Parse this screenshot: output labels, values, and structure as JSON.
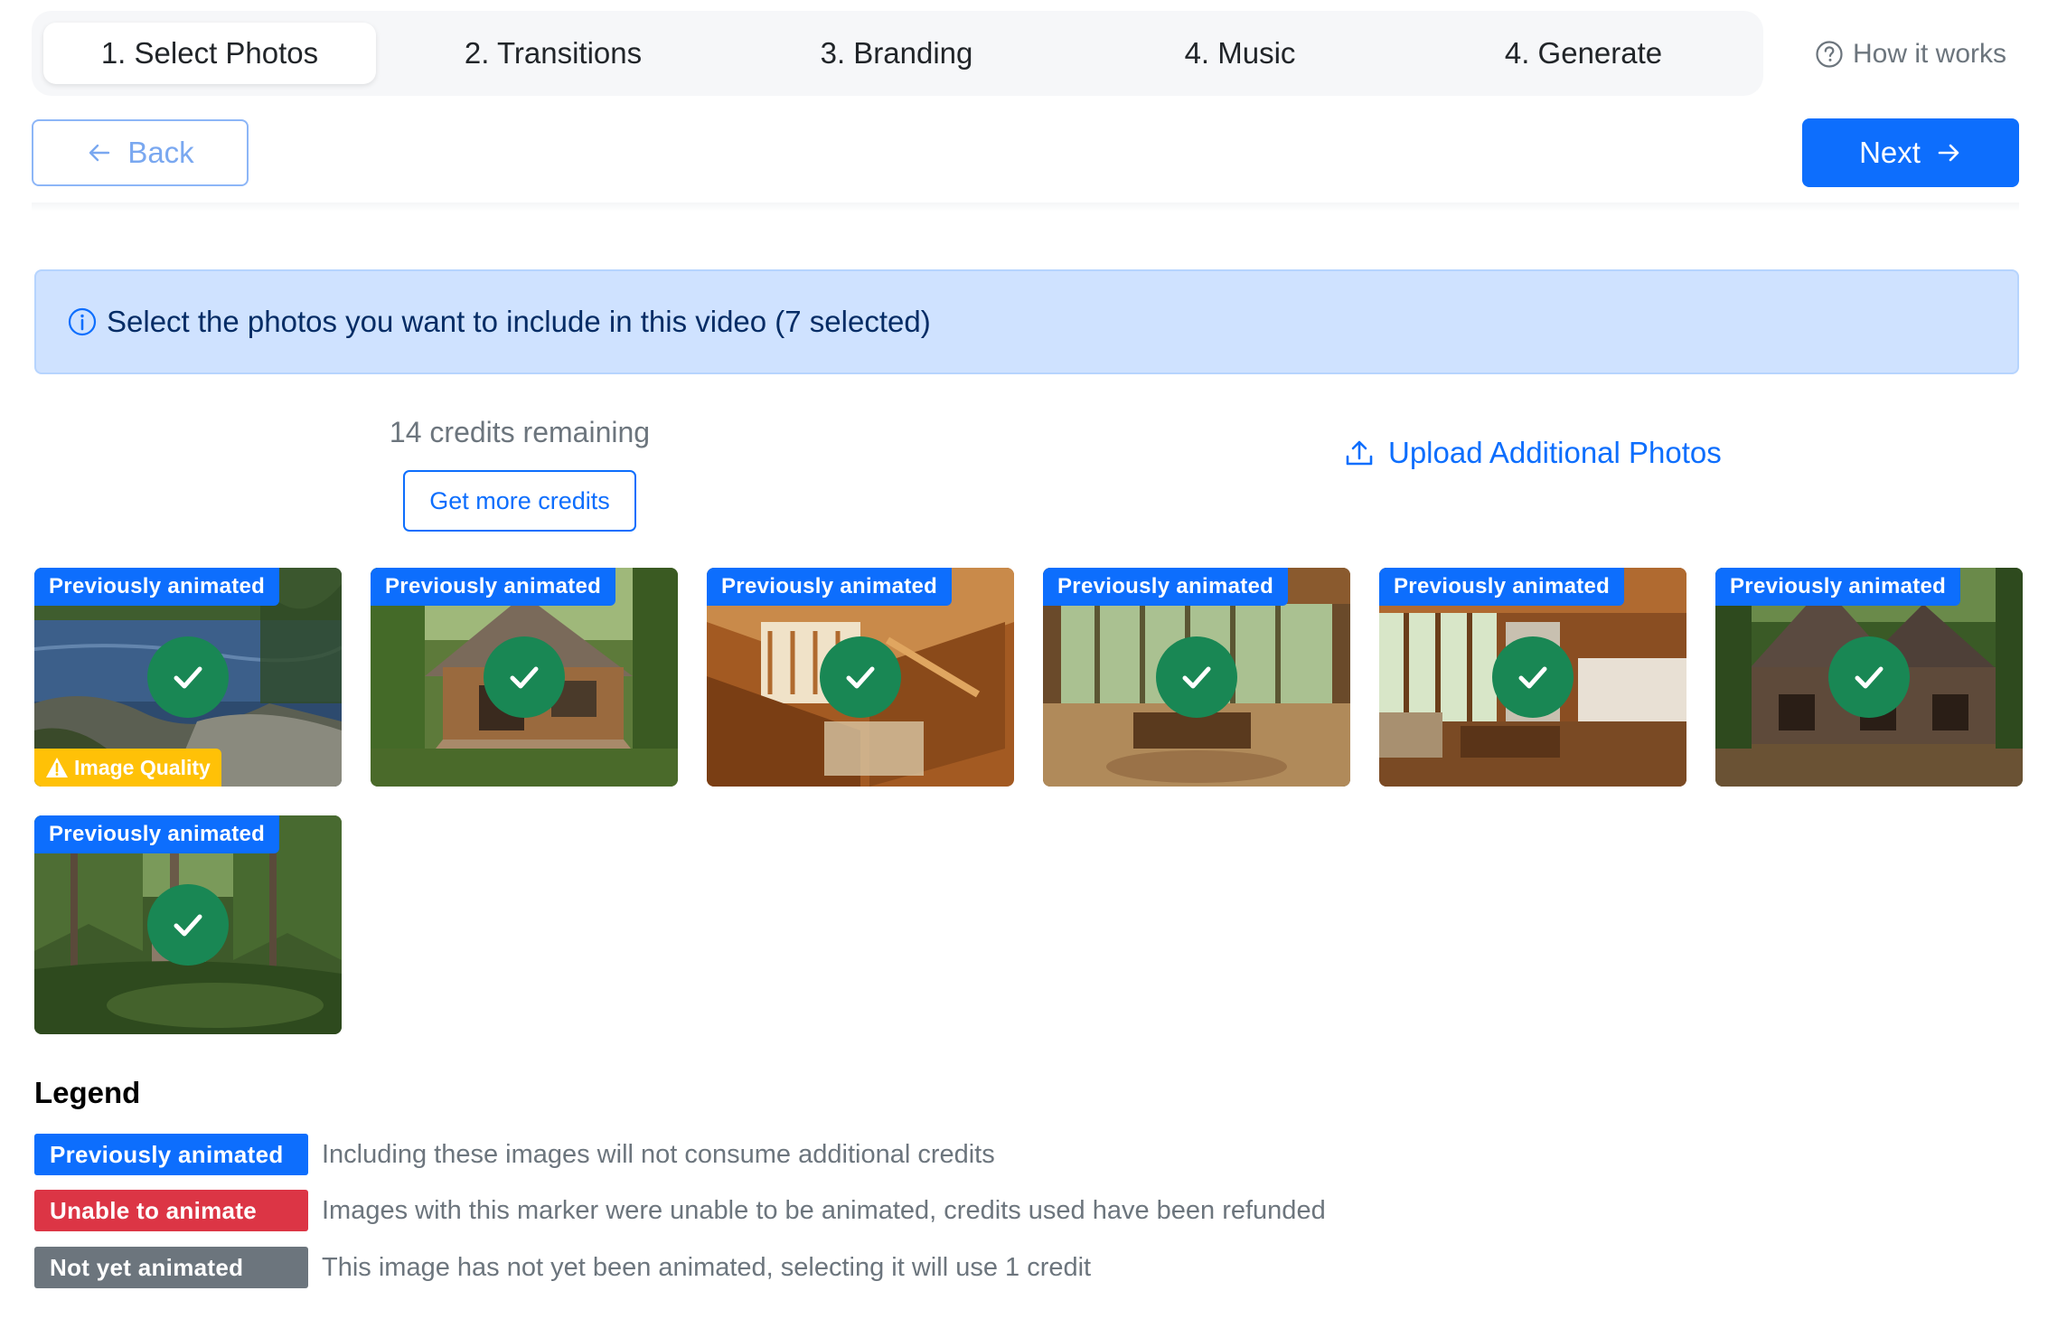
{
  "steps": [
    {
      "label": "1. Select Photos",
      "active": true
    },
    {
      "label": "2. Transitions",
      "active": false
    },
    {
      "label": "3. Branding",
      "active": false
    },
    {
      "label": "4. Music",
      "active": false
    },
    {
      "label": "4. Generate",
      "active": false
    }
  ],
  "help": {
    "label": "How it works",
    "icon": "question-circle-icon"
  },
  "nav": {
    "back_label": "Back",
    "next_label": "Next"
  },
  "alert": {
    "text": "Select the photos you want to include in this video (7 selected)",
    "icon": "info-circle-icon"
  },
  "credits": {
    "remaining_text": "14 credits remaining",
    "button_label": "Get more credits"
  },
  "upload": {
    "label": "Upload Additional Photos",
    "icon": "upload-icon"
  },
  "photos": [
    {
      "badge": "Previously animated",
      "selected": true,
      "warning": "Image Quality",
      "scene": "lake"
    },
    {
      "badge": "Previously animated",
      "selected": true,
      "warning": "",
      "scene": "cabin-exterior"
    },
    {
      "badge": "Previously animated",
      "selected": true,
      "warning": "",
      "scene": "stairwell"
    },
    {
      "badge": "Previously animated",
      "selected": true,
      "warning": "",
      "scene": "sunroom"
    },
    {
      "badge": "Previously animated",
      "selected": true,
      "warning": "",
      "scene": "living-room"
    },
    {
      "badge": "Previously animated",
      "selected": true,
      "warning": "",
      "scene": "cottage-exterior"
    },
    {
      "badge": "Previously animated",
      "selected": true,
      "warning": "",
      "scene": "forest"
    }
  ],
  "legend": {
    "title": "Legend",
    "items": [
      {
        "chip": "Previously animated",
        "color": "#0d6efd",
        "description": "Including these images will not consume additional credits"
      },
      {
        "chip": "Unable to animate",
        "color": "#dc3545",
        "description": "Images with this marker were unable to be animated, credits used have been refunded"
      },
      {
        "chip": "Not yet animated",
        "color": "#6c757d",
        "description": "This image has not yet been animated, selecting it will use 1 credit"
      }
    ]
  }
}
